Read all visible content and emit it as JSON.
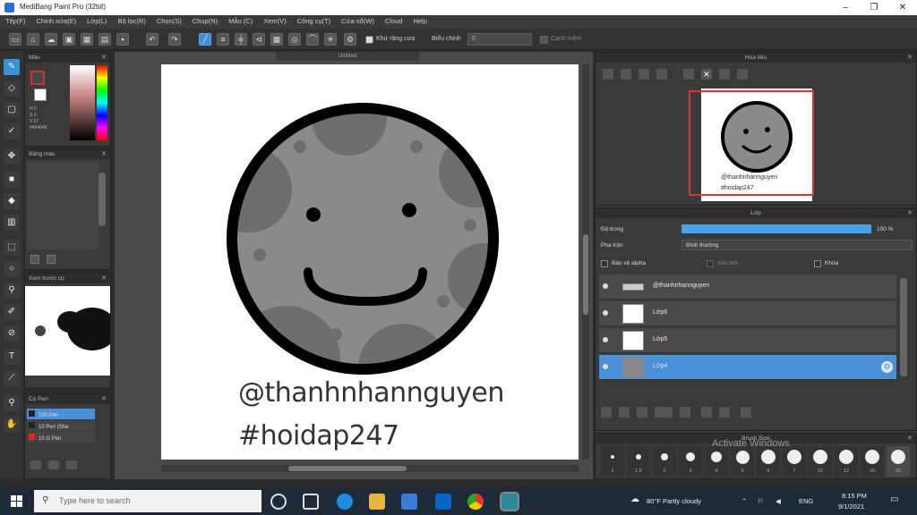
{
  "window": {
    "title": "MediBang Paint Pro (32bit)",
    "minimize": "–",
    "maximize": "❐",
    "close": "✕"
  },
  "menu": [
    "Tệp(F)",
    "Chỉnh sửa(E)",
    "Lớp(L)",
    "Bộ lọc(R)",
    "Chọn(S)",
    "Chụp(N)",
    "Mẫu (C)",
    "Xem(V)",
    "Công cụ(T)",
    "Cửa sổ(W)",
    "Cloud",
    "Help"
  ],
  "toolbar": {
    "auto_close_label": "Khử răng cưa",
    "mode_label": "Biểu chỉnh",
    "mode_value": "0",
    "snap_label": "Cạnh mềm"
  },
  "color_panel": {
    "title": "Màu",
    "hex": "#464646",
    "h_label": "H 0",
    "s_label": "S 0",
    "v_label": "V 27"
  },
  "palette_panel": {
    "title": "Bảng màu"
  },
  "preview_panel": {
    "title": "Xem trước cọ"
  },
  "pen_panel": {
    "title": "Cọ Pen",
    "pens": [
      {
        "size": "100",
        "name": "Pen"
      },
      {
        "size": "10",
        "name": "Pen (Sha"
      },
      {
        "size": "15",
        "name": "G Pen"
      }
    ]
  },
  "canvas": {
    "tab": "Untitled",
    "caption1": "@thanhnhannguyen",
    "caption2": "#hoidap247"
  },
  "navigator": {
    "title": "Hoa tiêu",
    "caption1": "@thanhnhannguyen",
    "caption2": "#hoidap247"
  },
  "layer_panel": {
    "title": "Lớp",
    "opacity_label": "Độ trong",
    "opacity_value": "100 %",
    "opacity": 1.0,
    "blend_label": "Pha trộn",
    "blend_value": "Bình thường",
    "protect_alpha": "Bảo vệ alpha",
    "clipping": "Xén bớt",
    "lock": "Khóa",
    "layers": [
      {
        "name": "@thanhnhannguyen",
        "selected": false
      },
      {
        "name": "Lớp6",
        "selected": false
      },
      {
        "name": "Lớp5",
        "selected": false
      },
      {
        "name": "Lớp4",
        "selected": true
      }
    ]
  },
  "brush_size_panel": {
    "title": "Brush Size",
    "watermark": "Activate Windows",
    "sizes": [
      "1",
      "1.5",
      "2",
      "3",
      "4",
      "5",
      "6",
      "7",
      "10",
      "12",
      "15",
      "20"
    ]
  },
  "taskbar": {
    "search_placeholder": "Type here to search",
    "weather": "80°F  Partly cloudy",
    "lang": "ENG",
    "time": "8:15 PM",
    "date": "9/1/2021"
  },
  "colors": {
    "accent": "#4a90d9",
    "moon_fill": "#8a8a8a",
    "moon_spots": "#6e6e6e",
    "outline": "#000000"
  }
}
